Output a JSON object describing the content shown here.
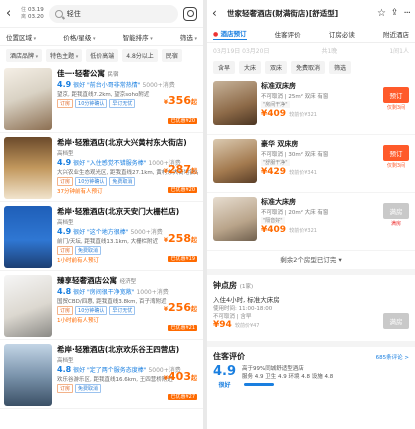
{
  "left": {
    "dates": {
      "in_label": "住",
      "in_date": "03.19",
      "out_label": "离",
      "out_date": "03.20"
    },
    "search_query": "轻住",
    "filters": [
      "位置区域",
      "价格/星级",
      "智能排序",
      "筛选"
    ],
    "chips": [
      "酒店品牌",
      "特色主题",
      "低价高端",
      "4.8分以上",
      "民宿"
    ],
    "hotels": [
      {
        "name": "佳一·轻奢公寓",
        "type": "民宿",
        "score": "4.9",
        "score_word": "很好",
        "quote": "\"前台小哥非常热情\"",
        "reviews": "5000+消费",
        "meta": "望京, 距我直线7.2km, 望京soho附近",
        "tags": [
          "订房",
          "10分钟确认",
          "早订无忧"
        ],
        "price": "356",
        "discount": "已优惠¥20",
        "hint": ""
      },
      {
        "name": "希岸·轻雅酒店(北京大兴黄村东大街店)",
        "type": "高档型",
        "score": "4.9",
        "score_word": "很好",
        "quote": "\"入住感觉不错服务棒\"",
        "reviews": "1000+消费",
        "meta": "大兴农业生态观光区, 距我直线27.1km, 黄村东大街地铁站",
        "tags": [
          "订房",
          "10分钟确认",
          "免费取消"
        ],
        "price": "287",
        "discount": "已优惠¥20",
        "hint": "37分钟前有人预订"
      },
      {
        "name": "希岸·轻雅酒店(北京天安门大栅栏店)",
        "type": "高档型",
        "score": "4.9",
        "score_word": "很好",
        "quote": "\"这个地方很棒\"",
        "reviews": "5000+消费",
        "meta": "前门/天坛, 距我直线13.1km, 大栅栏附近",
        "tags": [
          "订房",
          "免费取消"
        ],
        "price": "258",
        "discount": "已优惠¥19",
        "hint": "1小时前有人预订"
      },
      {
        "name": "臻享轻奢酒店公寓",
        "type": "经济型",
        "score": "4.8",
        "score_word": "很好",
        "quote": "\"房间很干净宽敞\"",
        "reviews": "1000+消费",
        "meta": "国贸CBD/四惠, 距我直线3.8km, 百子湾附近",
        "tags": [
          "订房",
          "10分钟确认",
          "早订无忧"
        ],
        "price": "256",
        "discount": "已优惠¥21",
        "hint": "1小时前有人预订"
      },
      {
        "name": "希岸·轻雅酒店(北京欢乐谷王四营店)",
        "type": "高档型",
        "score": "4.8",
        "score_word": "很好",
        "quote": "\"定了两个服务态度棒\"",
        "reviews": "5000+消费",
        "meta": "欢乐谷游乐区, 距我直线16.6km, 王四营桥附近",
        "tags": [
          "订房",
          "免费取消"
        ],
        "price": "403",
        "discount": "已优惠¥27",
        "hint": ""
      }
    ]
  },
  "right": {
    "title": "世家轻奢酒店(财满街店)[舒适型]",
    "tabs": {
      "pin": "酒店预订",
      "t1": "住客评价",
      "t2": "订房必读",
      "t3": "附近酒店"
    },
    "datebar": [
      "03月19日 03月20日",
      "共1晚",
      "1间1人"
    ],
    "room_chips": [
      "含早",
      "大床",
      "双床",
      "免费取消",
      "筛选"
    ],
    "rooms": [
      {
        "name": "标准双床房",
        "sub": "不可取消 | 25m² 双床 有窗",
        "quote": "\"房间干净\"",
        "price": "409",
        "orig": "较前价¥321",
        "btn": "预订",
        "btn_sub": "仅剩3间",
        "grey": false
      },
      {
        "name": "豪华 双床房",
        "sub": "不可取消 | 30m² 双床 有窗",
        "quote": "\"舒服干净\"",
        "price": "429",
        "orig": "较前价¥341",
        "btn": "预订",
        "btn_sub": "仅剩3间",
        "grey": false
      },
      {
        "name": "标准大床房",
        "sub": "不可取消 | 20m² 大床 有窗",
        "quote": "\"隔音好\"",
        "price": "409",
        "orig": "较前价¥321",
        "btn": "满房",
        "btn_sub": "满房",
        "grey": true
      }
    ],
    "more_rooms": "剩余2个房型已订完",
    "hourly": {
      "title": "钟点房",
      "count": "(1家)",
      "desc": "入住4小时, 标准大床房",
      "time": "使用时间: 11:00-18:00",
      "note": "不可取消 | 含早",
      "price": "94",
      "orig": "较前价¥47",
      "btn": "满房"
    },
    "review": {
      "title": "住客评价",
      "link": "685条评论 >",
      "score": "4.9",
      "word": "很好",
      "line1": "高于99%同城舒适型酒店",
      "line2": "服务 4.9  卫生 4.9  环境 4.8  设施 4.8"
    }
  }
}
